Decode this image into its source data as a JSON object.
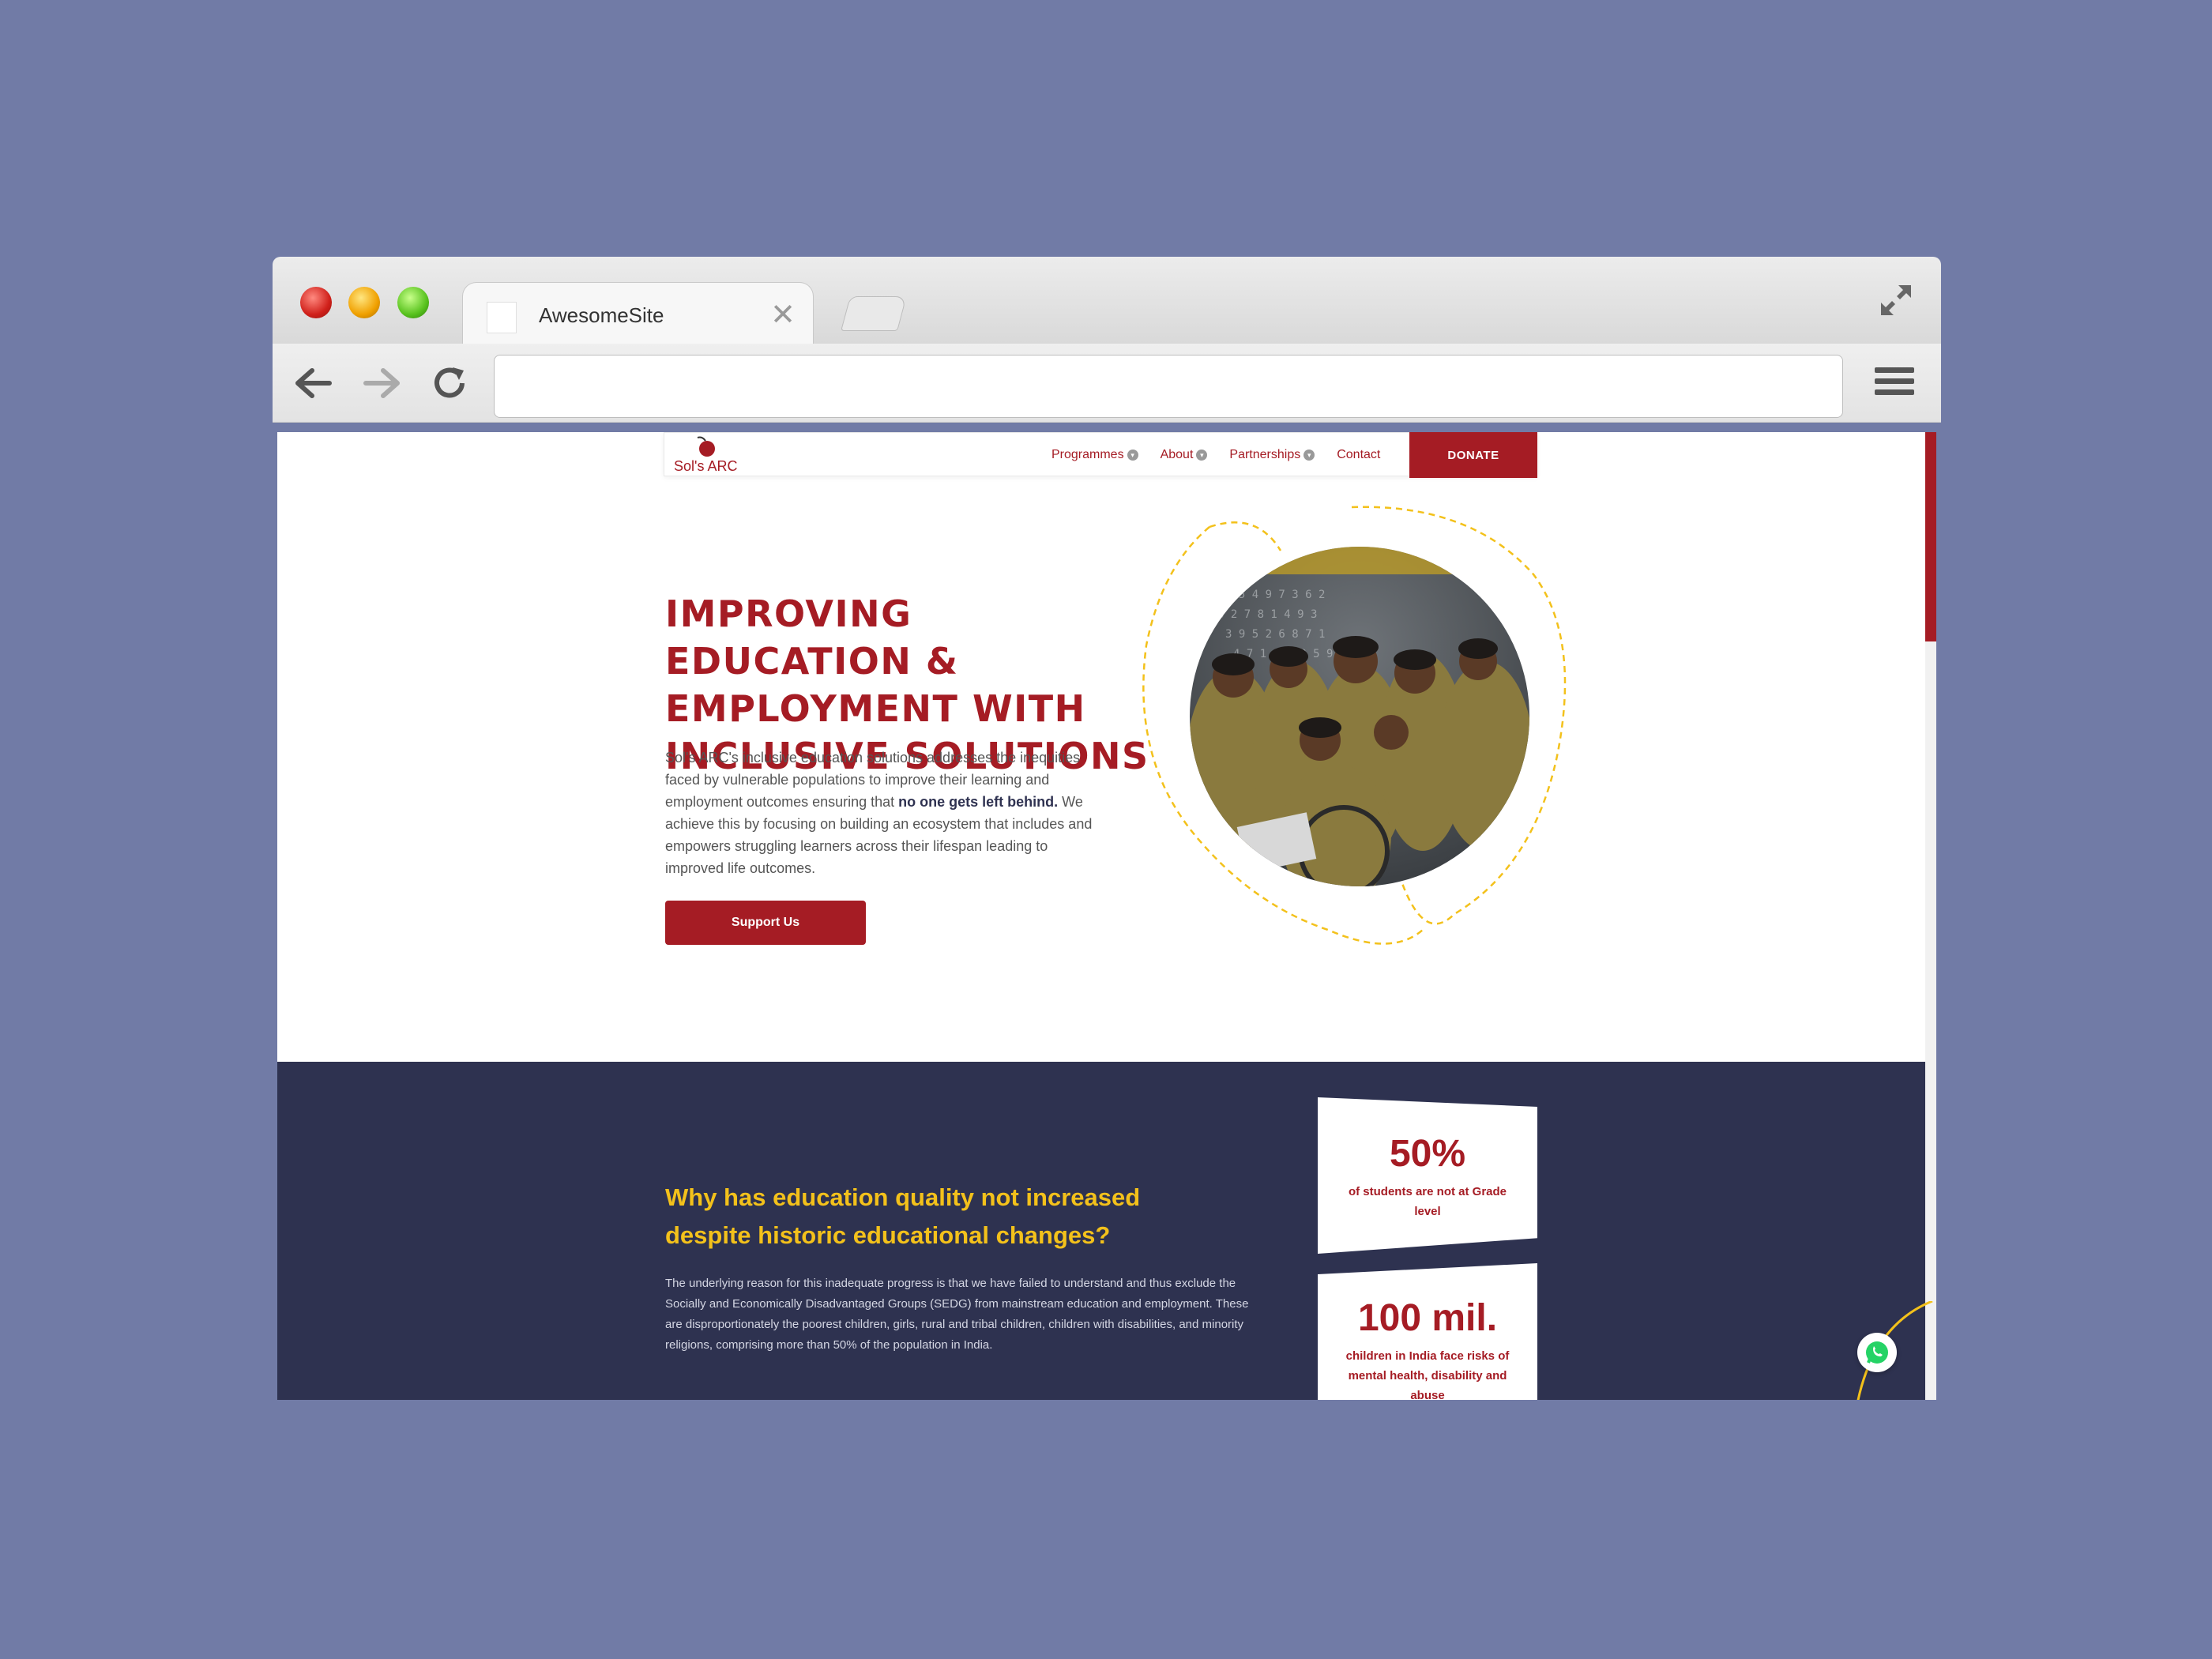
{
  "browser": {
    "tab_title": "AwesomeSite",
    "url": ""
  },
  "site": {
    "logo_text": "Sol's ARC",
    "nav": [
      "Programmes",
      "About",
      "Partnerships",
      "Contact"
    ],
    "donate_label": "DONATE",
    "brand_color": "#a51c24"
  },
  "hero": {
    "title": "IMPROVING EDUCATION & EMPLOYMENT WITH INCLUSIVE SOLUTIONS",
    "body_before": "Sol's ARC's inclusive education solutions addresses the inequities faced by vulnerable populations to improve their learning and employment outcomes ensuring that ",
    "body_bold": "no one gets left behind.",
    "body_after": " We achieve this by focusing on building an ecosystem that includes and empowers struggling learners across their lifespan leading to improved life outcomes.",
    "cta_label": "Support Us"
  },
  "why": {
    "title": "Why has education quality not increased despite historic educational changes?",
    "body": "The underlying reason for this inadequate progress is that we have failed to understand and thus exclude the Socially and Economically Disadvantaged Groups (SEDG) from mainstream education and employment. These are disproportionately the poorest children, girls, rural and tribal children, children with disabilities, and minority religions, comprising more than 50% of the population in India.",
    "accent_color": "#f3c11b",
    "background": "#2e3250"
  },
  "stats": [
    {
      "value": "50%",
      "label": "of students are not at Grade level"
    },
    {
      "value": "100 mil.",
      "label": "children in India face risks of mental health, disability and abuse"
    }
  ]
}
